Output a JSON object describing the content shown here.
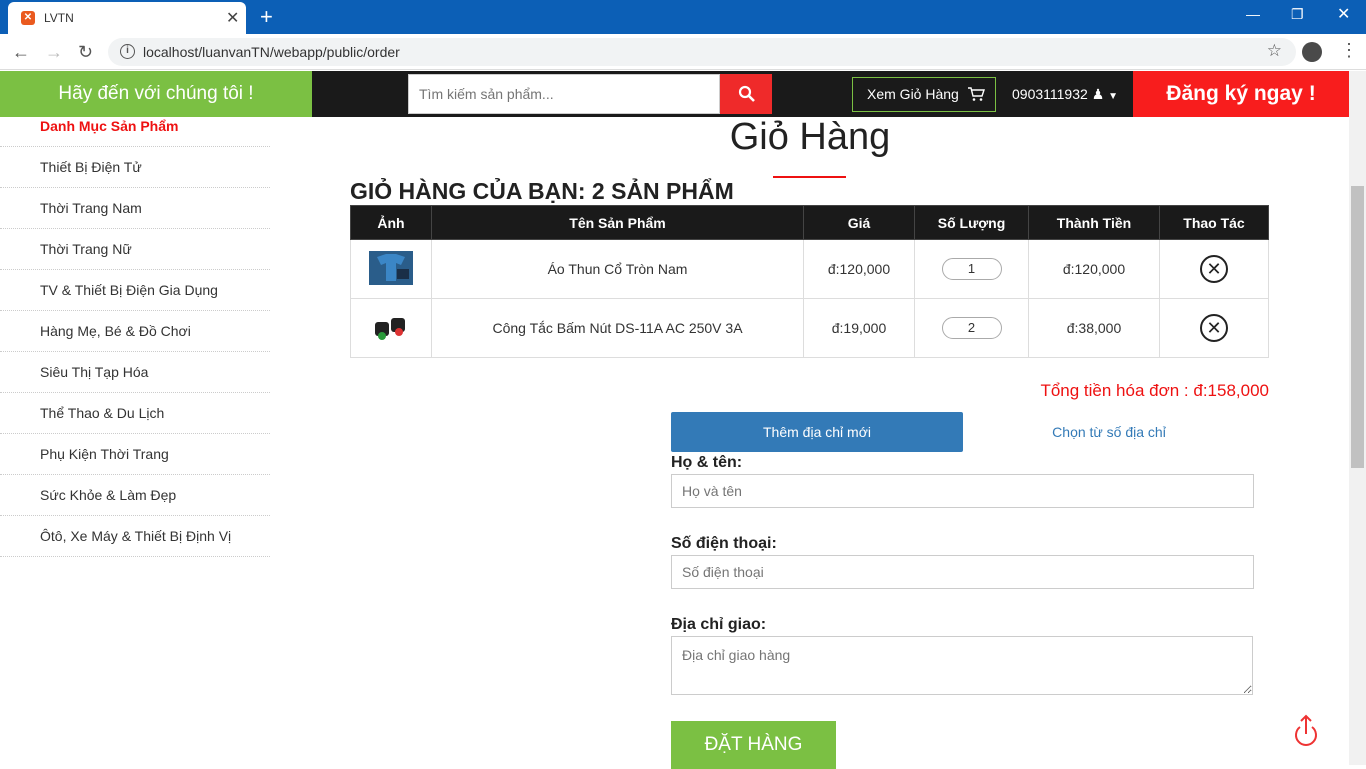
{
  "browser": {
    "tab_title": "LVTN",
    "url": "localhost/luanvanTN/webapp/public/order"
  },
  "header": {
    "tagline": "Hãy đến với chúng tôi !",
    "search_placeholder": "Tìm kiếm sản phẩm...",
    "cart_label": "Xem Giỏ Hàng",
    "phone": "0903111932",
    "register_label": "Đăng ký ngay !"
  },
  "sidebar": {
    "heading": "Danh Mục Sản Phẩm",
    "items": [
      "Thiết Bị Điện Tử",
      "Thời Trang Nam",
      "Thời Trang Nữ",
      "TV & Thiết Bị Điện Gia Dụng",
      "Hàng Mẹ, Bé & Đồ Chơi",
      "Siêu Thị Tạp Hóa",
      "Thể Thao & Du Lịch",
      "Phụ Kiện Thời Trang",
      "Sức Khỏe & Làm Đẹp",
      "Ôtô, Xe Máy & Thiết Bị Định Vị"
    ]
  },
  "main": {
    "title": "Giỏ Hàng",
    "cart_count": "GIỎ HÀNG CỦA BẠN: 2 SẢN PHẨM",
    "columns": [
      "Ảnh",
      "Tên Sản Phẩm",
      "Giá",
      "Số Lượng",
      "Thành Tiền",
      "Thao Tác"
    ],
    "rows": [
      {
        "name": "Áo Thun Cổ Tròn Nam",
        "price": "đ:120,000",
        "qty": "1",
        "subtotal": "đ:120,000"
      },
      {
        "name": "Công Tắc Bấm Nút DS-11A AC 250V 3A",
        "price": "đ:19,000",
        "qty": "2",
        "subtotal": "đ:38,000"
      }
    ],
    "total": "Tổng tiền hóa đơn : đ:158,000",
    "add_address": "Thêm địa chỉ mới",
    "pick_address": "Chọn từ số địa chỉ",
    "name_label": "Họ & tên:",
    "name_placeholder": "Họ và tên",
    "phone_label": "Số điện thoại:",
    "phone_placeholder": "Số điện thoại",
    "address_label": "Địa chỉ giao:",
    "address_placeholder": "Địa chỉ giao hàng",
    "order_button": "ĐẶT HÀNG"
  }
}
